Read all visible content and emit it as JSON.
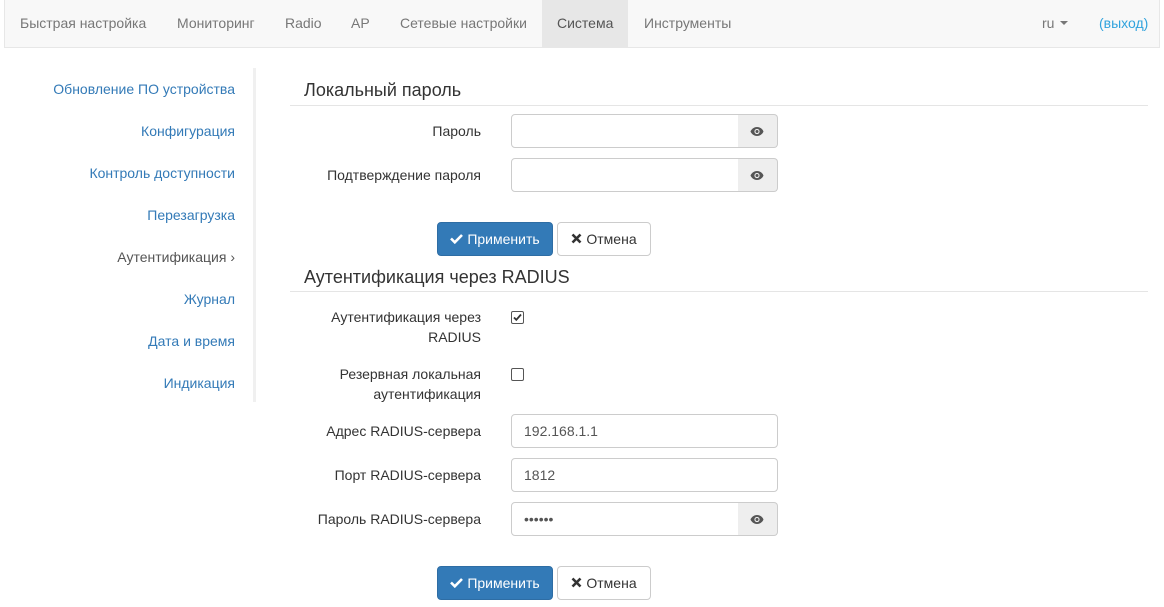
{
  "nav": {
    "items": [
      "Быстрая настройка",
      "Мониторинг",
      "Radio",
      "AP",
      "Сетевые настройки",
      "Система",
      "Инструменты"
    ],
    "active": "Система",
    "lang": "ru",
    "logout": "(выход)"
  },
  "sidebar": {
    "items": [
      "Обновление ПО устройства",
      "Конфигурация",
      "Контроль доступности",
      "Перезагрузка",
      "Аутентификация ›",
      "Журнал",
      "Дата и время",
      "Индикация"
    ],
    "current": "Аутентификация ›"
  },
  "local_password": {
    "title": "Локальный пароль",
    "password_label": "Пароль",
    "password_value": "",
    "confirm_label": "Подтверждение пароля",
    "confirm_value": ""
  },
  "buttons": {
    "apply": "Применить",
    "cancel": "Отмена"
  },
  "radius": {
    "title": "Аутентификация через RADIUS",
    "enable_label_1": "Аутентификация через",
    "enable_label_2": "RADIUS",
    "enable_checked": true,
    "fallback_label_1": "Резервная локальная",
    "fallback_label_2": "аутентификация",
    "fallback_checked": false,
    "server_label": "Адрес RADIUS-сервера",
    "server_value": "192.168.1.1",
    "port_label": "Порт RADIUS-сервера",
    "port_value": "1812",
    "secret_label": "Пароль RADIUS-сервера",
    "secret_value": "••••••"
  },
  "colors": {
    "primary": "#337ab7",
    "link": "#337ab7",
    "logout": "#31a3dd",
    "navbar_bg": "#f8f8f8",
    "nav_active_bg": "#e7e7e7"
  },
  "icons": {
    "eye": "eye-icon",
    "check": "check-icon",
    "close": "close-icon",
    "caret": "caret-down-icon"
  }
}
